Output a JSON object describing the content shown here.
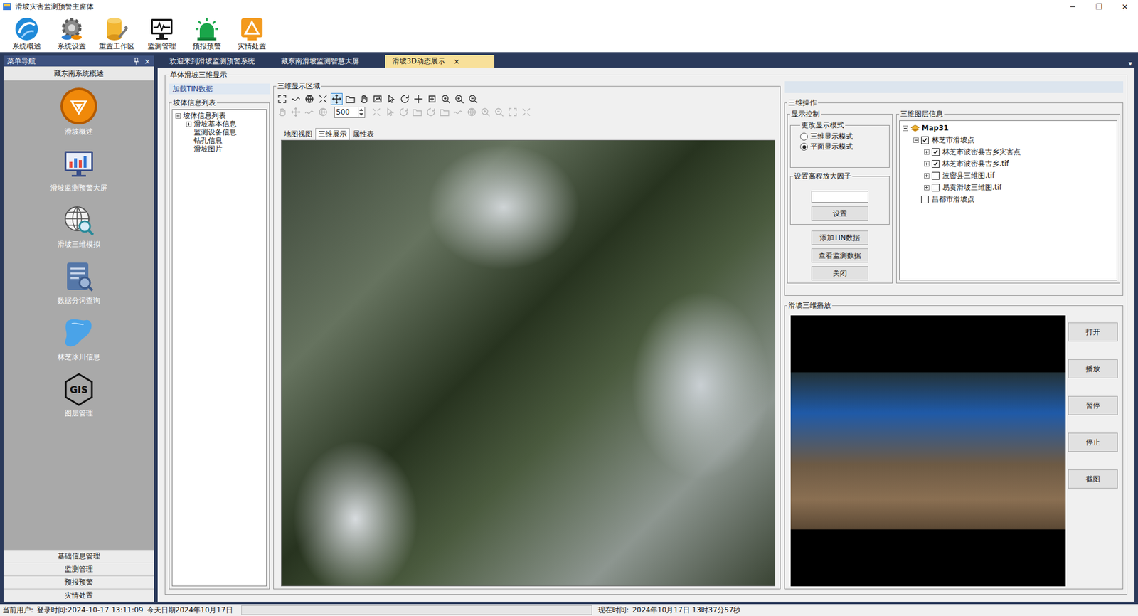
{
  "window": {
    "title": "滑坡灾害监测预警主窗体",
    "controls": [
      "─",
      "❐",
      "✕"
    ]
  },
  "toolbar": [
    {
      "label": "系统概述"
    },
    {
      "label": "系统设置"
    },
    {
      "label": "重置工作区"
    },
    {
      "label": "监测管理"
    },
    {
      "label": "预报预警"
    },
    {
      "label": "灾情处置"
    }
  ],
  "nav": {
    "title": "菜单导航",
    "close": "×",
    "section": "藏东南系统概述",
    "items": [
      {
        "label": "滑坡概述"
      },
      {
        "label": "滑坡监测预警大屏"
      },
      {
        "label": "滑坡三维模拟"
      },
      {
        "label": "数据分词查询"
      },
      {
        "label": "林芝冰川信息"
      },
      {
        "label": "图层管理",
        "icon_text": "GIS"
      }
    ],
    "bottom": [
      "基础信息管理",
      "监测管理",
      "预报预警",
      "灾情处置"
    ]
  },
  "tabs": [
    {
      "label": "欢迎来到滑坡监测预警系统",
      "selected": false,
      "close": ""
    },
    {
      "label": "藏东南滑坡监测智慧大屏",
      "selected": false,
      "close": ""
    },
    {
      "label": "滑坡3D动态展示",
      "selected": true,
      "close": "×"
    }
  ],
  "tab_menu": "▾",
  "main": {
    "title": "单体滑坡三维显示",
    "load_tin": "加载TIN数据",
    "slope_group": "坡体信息列表",
    "slope_tree": {
      "label": "坡体信息列表",
      "expanded": true,
      "children": [
        {
          "label": "滑坡基本信息",
          "expandable": true,
          "expanded": false
        },
        {
          "label": "监测设备信息",
          "expandable": false,
          "expanded": false
        },
        {
          "label": "钻孔信息",
          "expandable": false,
          "expanded": false
        },
        {
          "label": "滑坡图片",
          "expandable": false,
          "expanded": false
        }
      ]
    }
  },
  "view": {
    "title": "三维显示区域",
    "row1": [
      {
        "selected": false,
        "disabled": false
      },
      {
        "selected": false,
        "disabled": false
      },
      {
        "selected": false,
        "disabled": false
      },
      {
        "selected": false,
        "disabled": false
      },
      {
        "selected": true,
        "disabled": false
      },
      {
        "selected": false,
        "disabled": false
      },
      {
        "selected": false,
        "disabled": false
      },
      {
        "selected": false,
        "disabled": false
      },
      {
        "selected": false,
        "disabled": false
      },
      {
        "selected": false,
        "disabled": false
      },
      {
        "selected": false,
        "disabled": false
      },
      {
        "selected": false,
        "disabled": false
      },
      {
        "selected": false,
        "disabled": false
      },
      {
        "selected": false,
        "disabled": false
      },
      {
        "selected": false,
        "disabled": false
      }
    ],
    "row2_left": [
      {
        "selected": false,
        "disabled": true
      },
      {
        "selected": false,
        "disabled": true
      },
      {
        "selected": false,
        "disabled": true
      },
      {
        "selected": false,
        "disabled": true
      }
    ],
    "scale": "500",
    "row2_right": [
      {
        "selected": false,
        "disabled": true
      },
      {
        "selected": false,
        "disabled": true
      },
      {
        "selected": false,
        "disabled": true
      },
      {
        "selected": false,
        "disabled": true
      },
      {
        "selected": false,
        "disabled": true
      },
      {
        "selected": false,
        "disabled": true
      },
      {
        "selected": false,
        "disabled": true
      },
      {
        "selected": false,
        "disabled": true
      },
      {
        "selected": false,
        "disabled": true
      },
      {
        "selected": false,
        "disabled": true
      },
      {
        "selected": false,
        "disabled": true
      },
      {
        "selected": false,
        "disabled": true
      }
    ],
    "tabs": [
      {
        "label": "地图视图",
        "selected": false
      },
      {
        "label": "三维展示",
        "selected": true
      },
      {
        "label": "属性表",
        "selected": false
      }
    ]
  },
  "ops": {
    "title": "三维操作",
    "control_title": "显示控制",
    "mode_title": "更改显示模式",
    "modes": [
      {
        "label": "三维显示模式",
        "selected": false
      },
      {
        "label": "平面显示模式",
        "selected": true
      }
    ],
    "factor_title": "设置高程放大因子",
    "factor_value": "",
    "factor_button": "设置",
    "buttons": [
      "添加TIN数据",
      "查看监测数据",
      "关闭"
    ]
  },
  "layers": {
    "title": "三维图层信息",
    "root": {
      "label": "Map31",
      "expanded": true
    },
    "items": [
      {
        "label": "林芝市滑坡点",
        "level": 1,
        "expandable": true,
        "expanded": true,
        "checked": true
      },
      {
        "label": "林芝市波密县古乡灾害点",
        "level": 2,
        "expandable": true,
        "expanded": false,
        "checked": true
      },
      {
        "label": "林芝市波密县古乡.tif",
        "level": 2,
        "expandable": true,
        "expanded": false,
        "checked": true
      },
      {
        "label": "波密县三维图.tif",
        "level": 2,
        "expandable": true,
        "expanded": false,
        "checked": false
      },
      {
        "label": "易贡滑坡三维图.tif",
        "level": 2,
        "expandable": true,
        "expanded": false,
        "checked": false
      },
      {
        "label": "昌都市滑坡点",
        "level": 1,
        "expandable": false,
        "expanded": false,
        "checked": false
      }
    ]
  },
  "player": {
    "title": "滑坡三维播放",
    "buttons": [
      "打开",
      "播放",
      "暂停",
      "停止",
      "截图"
    ]
  },
  "status": {
    "user": "当前用户:",
    "login": "登录时间:2024-10-17 13:11:09",
    "today": "今天日期2024年10月17日",
    "progress": 0,
    "now_label": "现在时间:",
    "now": "2024年10月17日 13时37分57秒"
  }
}
